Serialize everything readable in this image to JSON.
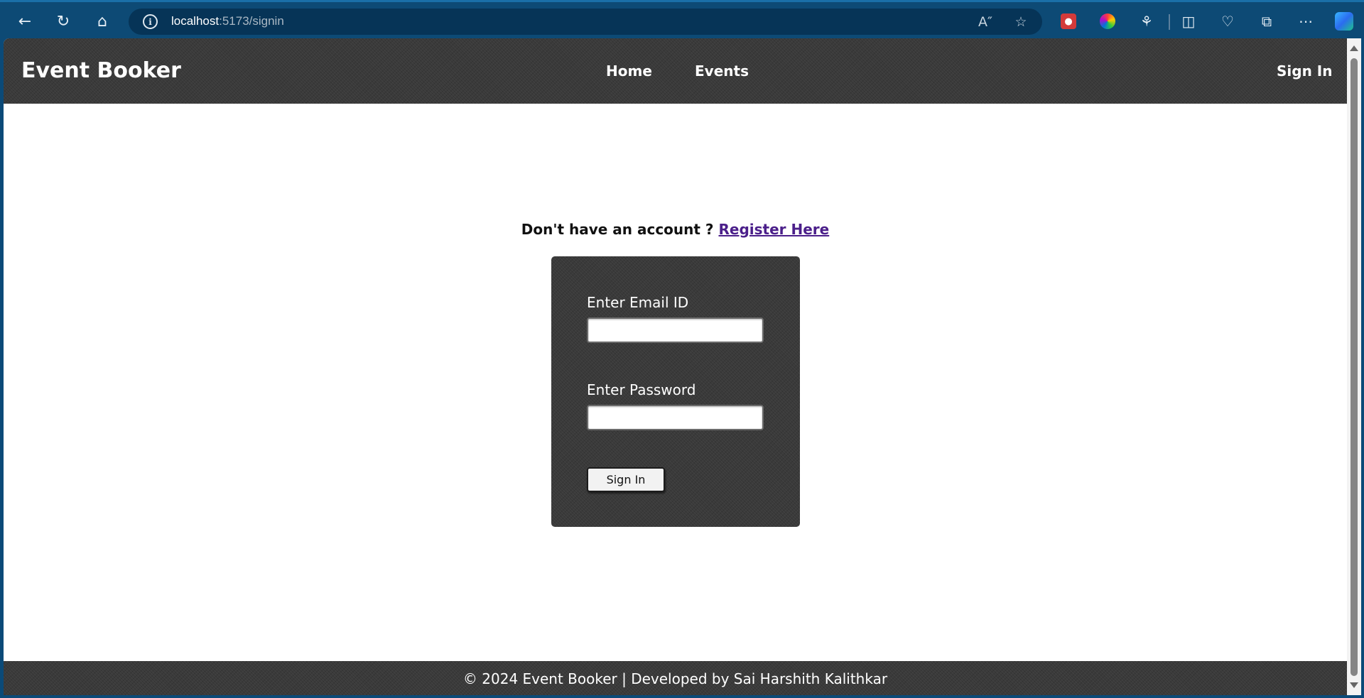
{
  "browser": {
    "url_host": "localhost",
    "url_path": ":5173/signin",
    "icons": {
      "back": "back-arrow-icon",
      "refresh": "refresh-icon",
      "home": "home-icon",
      "info": "site-info-icon",
      "read_aloud": "read-aloud-icon",
      "favorite": "star-icon",
      "extensions": "puzzle-icon",
      "split": "split-screen-icon",
      "health": "browser-essentials-icon",
      "collections": "collections-icon",
      "more": "more-icon",
      "copilot": "copilot-icon"
    }
  },
  "header": {
    "logo": "Event Booker",
    "nav": {
      "home": "Home",
      "events": "Events",
      "signin": "Sign In"
    }
  },
  "signin": {
    "prompt": "Don't have an account ?",
    "register_link": "Register Here",
    "email_label": "Enter Email ID",
    "email_value": "",
    "password_label": "Enter Password",
    "password_value": "",
    "submit_label": "Sign In"
  },
  "footer": {
    "text": "© 2024 Event Booker | Developed by Sai Harshith Kalithkar"
  },
  "colors": {
    "browser_chrome": "#0d4a75",
    "header_bg": "#3a3a3a",
    "link": "#4b1f8a"
  }
}
